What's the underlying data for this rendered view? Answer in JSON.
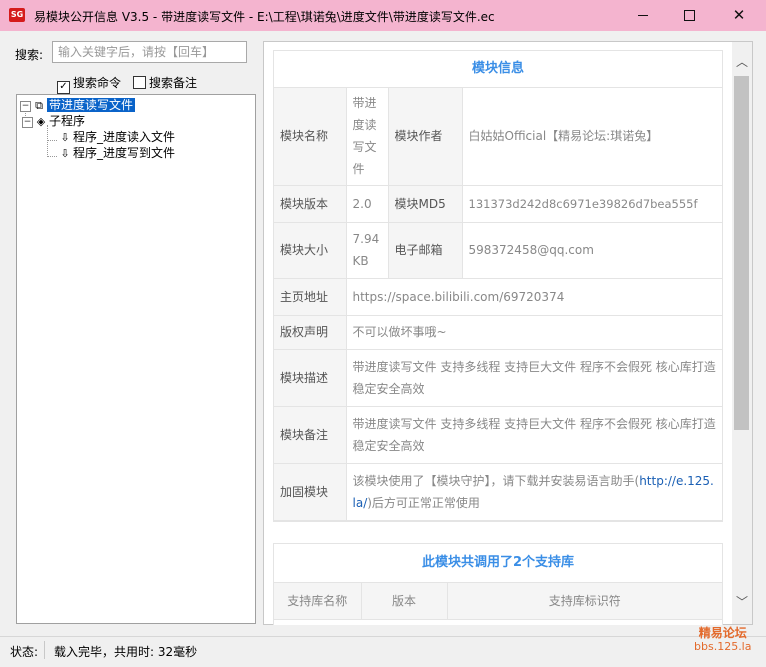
{
  "window": {
    "icon_text": "SG",
    "title": "易模块公开信息 V3.5 - 带进度读写文件 - E:\\工程\\琪诺兔\\进度文件\\带进度读写文件.ec",
    "close_glyph": "✕"
  },
  "search": {
    "label": "搜索:",
    "placeholder": "输入关键字后，请按【回车】",
    "check_cmd": "搜索命令",
    "check_cmd_checked": true,
    "check_note": "搜索备注",
    "check_note_checked": false
  },
  "tree": {
    "root": "带进度读写文件",
    "folder": "子程序",
    "items": [
      "程序_进度读入文件",
      "程序_进度写到文件"
    ]
  },
  "module_info": {
    "title": "模块信息",
    "name_label": "模块名称",
    "name": "带进度读写文件",
    "author_label": "模块作者",
    "author": "白姑姑Official【精易论坛:琪诺兔】",
    "version_label": "模块版本",
    "version": "2.0",
    "md5_label": "模块MD5",
    "md5": "131373d242d8c6971e39826d7bea555f",
    "size_label": "模块大小",
    "size": "7.94 KB",
    "email_label": "电子邮箱",
    "email": "598372458@qq.com",
    "homepage_label": "主页地址",
    "homepage": "https://space.bilibili.com/69720374",
    "copyright_label": "版权声明",
    "copyright": "不可以做坏事哦~",
    "desc_label": "模块描述",
    "desc": "带进度读写文件 支持多线程 支持巨大文件 程序不会假死 核心库打造 稳定安全高效",
    "note_label": "模块备注",
    "note": "带进度读写文件 支持多线程 支持巨大文件 程序不会假死 核心库打造 稳定安全高效",
    "protect_label": "加固模块",
    "protect_prefix": "该模块使用了【模块守护】，请下载并安装易语言助手(",
    "protect_link": "http://e.125.la/",
    "protect_suffix": ")后方可正常正常使用"
  },
  "libs": {
    "title": "此模块共调用了2个支持库",
    "col_name": "支持库名称",
    "col_version": "版本",
    "col_id": "支持库标识符"
  },
  "status": {
    "label": "状态:",
    "text": "载入完毕，共用时: 32毫秒"
  },
  "watermark": {
    "name": "精易论坛",
    "url": "bbs.125.la"
  }
}
